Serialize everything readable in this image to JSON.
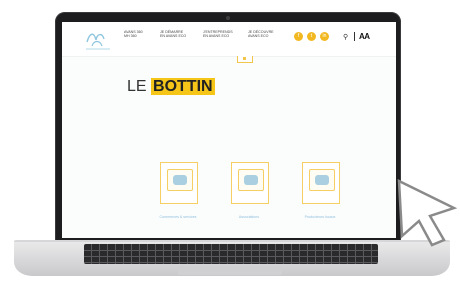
{
  "header": {
    "nav": [
      {
        "line1": "AVANS 360",
        "line2": "MH 360"
      },
      {
        "line1": "JE DÉMARRE",
        "line2": "EN AVANS ECO"
      },
      {
        "line1": "J'ENTREPRENDS",
        "line2": "EN AVANS ECO"
      },
      {
        "line1": "JE DÉCOUVRE",
        "line2": "AVANS ECO"
      }
    ],
    "social": [
      "f",
      "t",
      "in"
    ],
    "search_icon": "search-icon",
    "font_size_toggle": "AA"
  },
  "page": {
    "title_plain": "LE ",
    "title_highlight": "BOTTIN"
  },
  "cards": [
    {
      "label": "Commerces & services",
      "icon": "cash-register-icon"
    },
    {
      "label": "Associations",
      "icon": "handshake-icon"
    },
    {
      "label": "Producteurs locaux",
      "icon": "vegetables-icon"
    }
  ],
  "colors": {
    "accent": "#f5c518",
    "text_blue": "#9cc7df",
    "laptop": "#1d1d1f"
  }
}
